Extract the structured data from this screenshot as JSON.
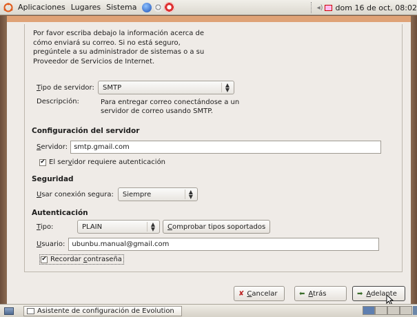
{
  "panel": {
    "menus": [
      "Aplicaciones",
      "Lugares",
      "Sistema"
    ],
    "clock": "dom 16 de oct, 08:02"
  },
  "wizard": {
    "intro": "Por favor escriba debajo la información acerca de cómo enviará su correo. Si no está seguro, pregúntele a su administrador de sistemas o a su Proveedor de Servicios de Internet.",
    "server_type": {
      "label_ak": "T",
      "label_rest": "ipo de servidor:",
      "value": "SMTP"
    },
    "description": {
      "label": "Descripción:",
      "text_line1": "Para entregar correo conectándose a un",
      "text_line2": "servidor de correo usando SMTP."
    },
    "server_config": {
      "heading": "Configuración del servidor",
      "server_label_ak": "S",
      "server_label_rest": "ervidor:",
      "server_value": "smtp.gmail.com",
      "auth_required_pre": "El ser",
      "auth_required_ak": "v",
      "auth_required_post": "idor requiere autenticación",
      "auth_required_checked": true
    },
    "security": {
      "heading": "Seguridad",
      "label_ak": "U",
      "label_rest": "sar conexión segura:",
      "value": "Siempre"
    },
    "authentication": {
      "heading": "Autenticación",
      "type_label_ak": "T",
      "type_label_rest": "ipo:",
      "type_value": "PLAIN",
      "check_types_ak": "C",
      "check_types_rest": "omprobar tipos soportados",
      "user_label_ak": "U",
      "user_label_rest": "suario:",
      "user_value": "ubunbu.manual@gmail.com",
      "remember_pre": "Recordar ",
      "remember_ak": "c",
      "remember_post": "ontraseña",
      "remember_checked": true
    },
    "buttons": {
      "cancel_ak": "C",
      "cancel_rest": "ancelar",
      "back_ak": "A",
      "back_rest": "trás",
      "next_ak": "A",
      "next_rest": "delante"
    }
  },
  "taskbar": {
    "window_title": "Asistente de configuración de Evolution"
  }
}
